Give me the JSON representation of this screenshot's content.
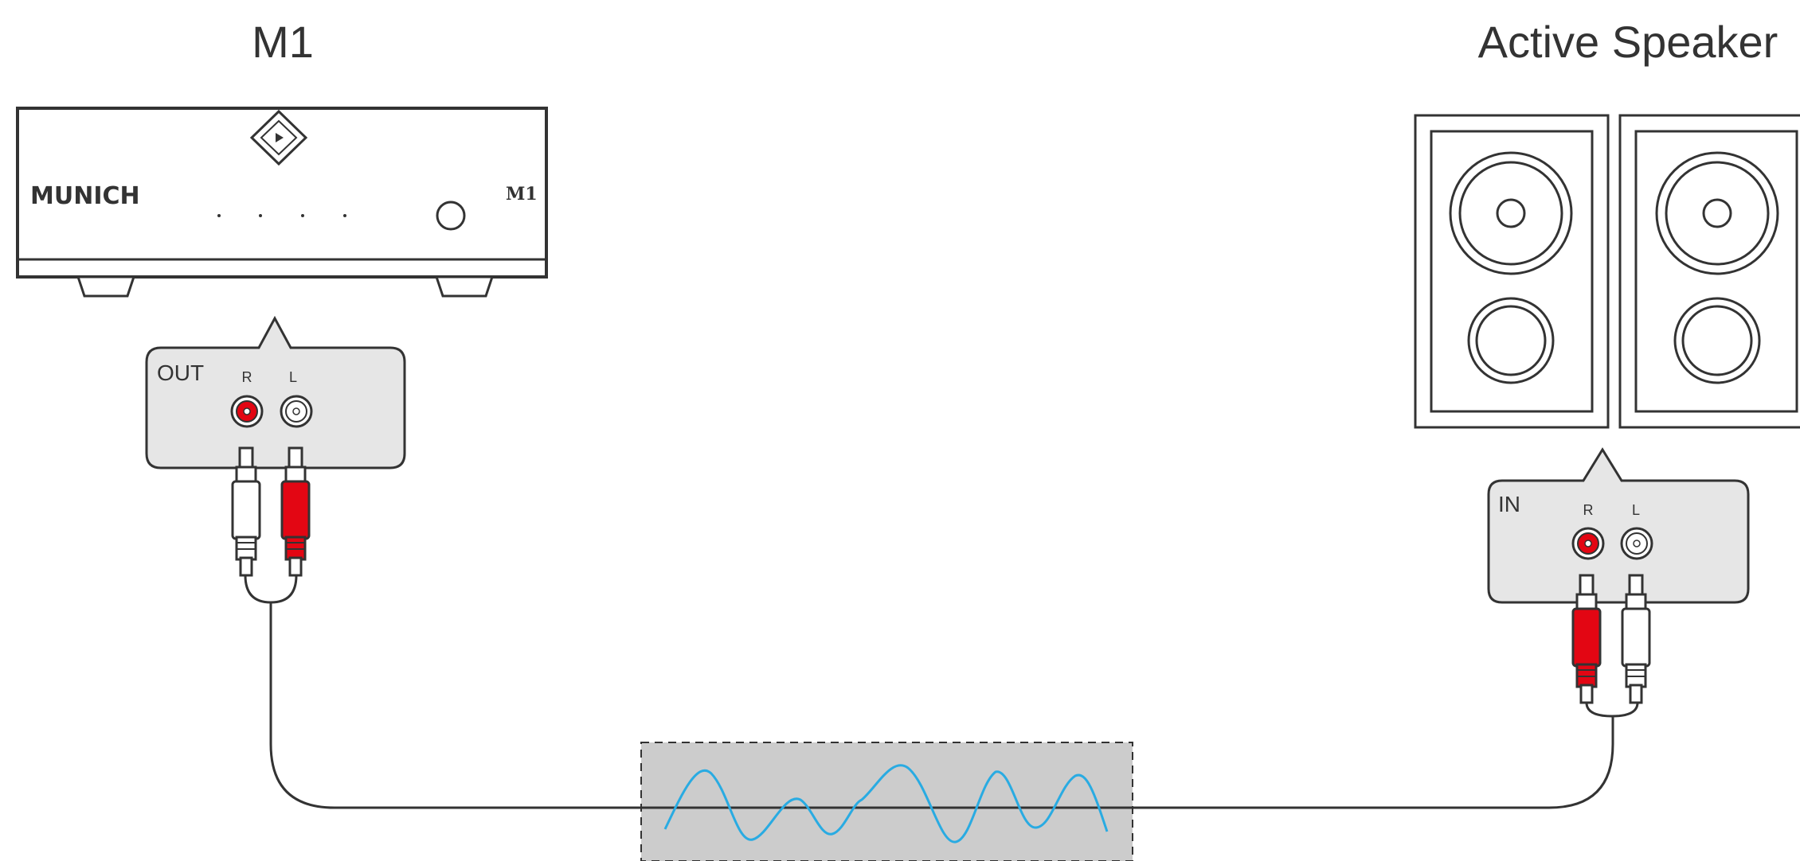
{
  "source": {
    "title": "M1",
    "brand": "MUNICH",
    "model_badge": "M1",
    "panel_label": "OUT",
    "right_label": "R",
    "left_label": "L"
  },
  "destination": {
    "title": "Active Speaker",
    "panel_label": "IN",
    "right_label": "R",
    "left_label": "L"
  },
  "colors": {
    "red_channel": "#e30613",
    "white_channel": "#ffffff",
    "line": "#333333",
    "panel_fill": "#e6e6e6",
    "wave": "#29abe2",
    "signal_box": "#cccccc"
  }
}
